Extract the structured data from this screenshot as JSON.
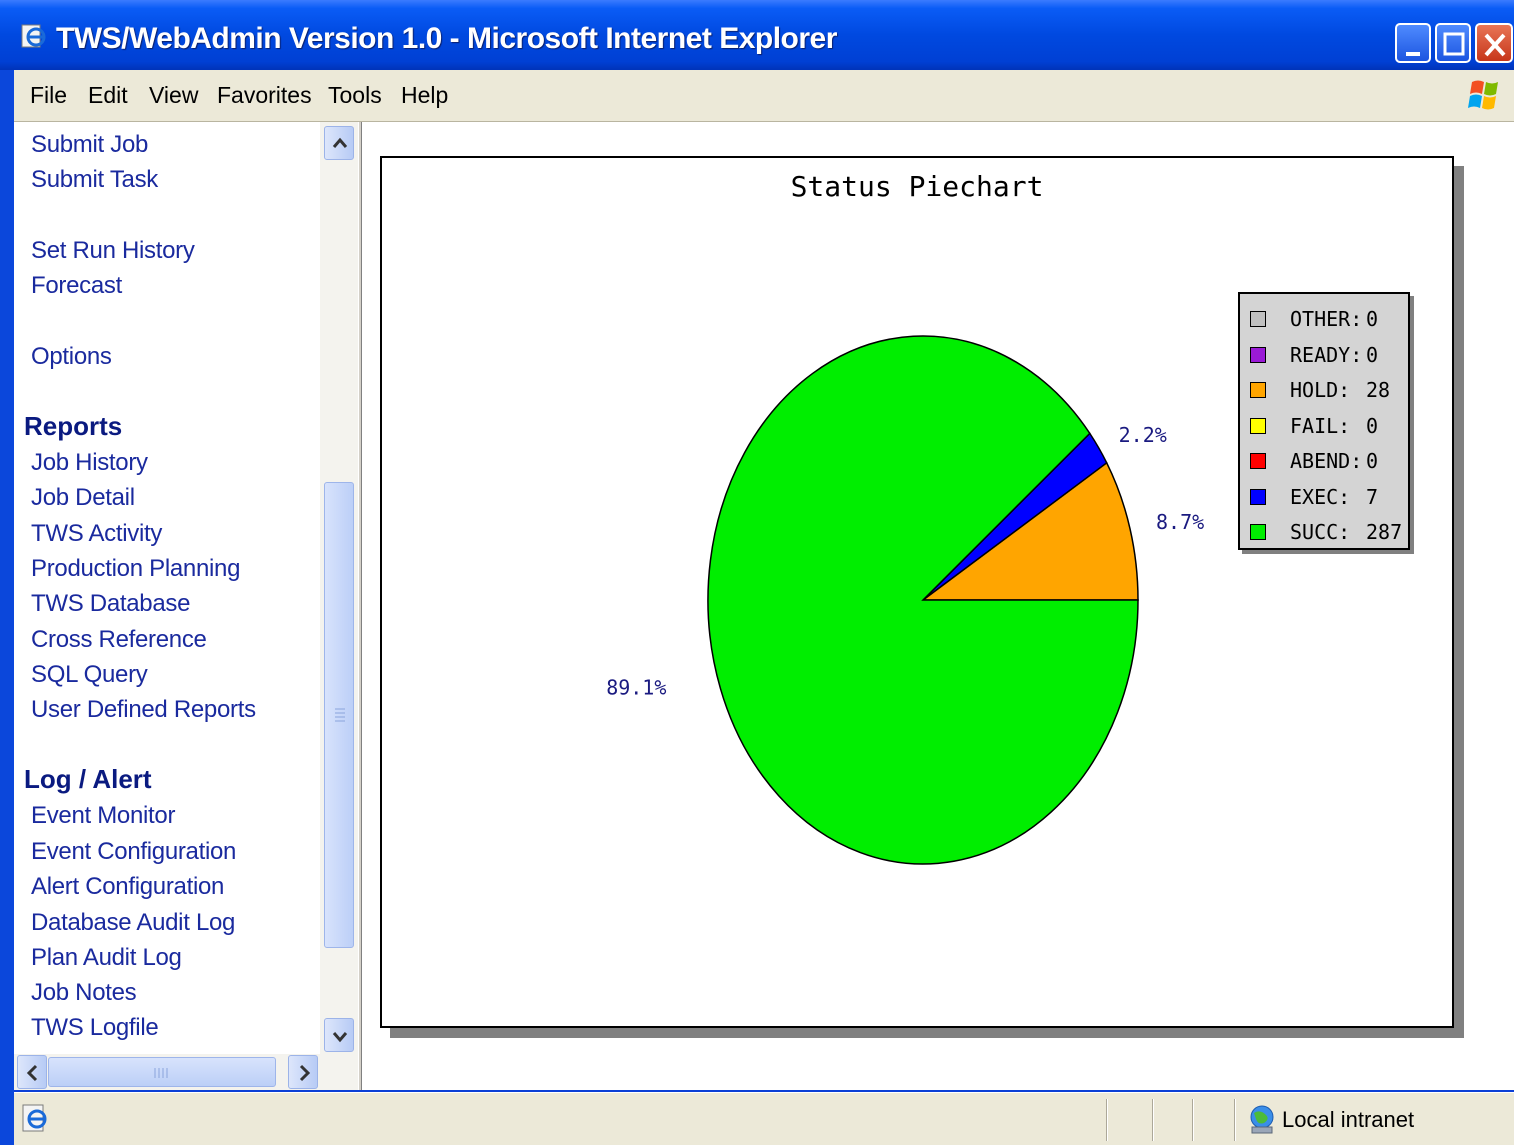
{
  "window": {
    "title": "TWS/WebAdmin Version 1.0 - Microsoft Internet Explorer"
  },
  "menu": {
    "file": "File",
    "edit": "Edit",
    "view": "View",
    "favorites": "Favorites",
    "tools": "Tools",
    "help": "Help"
  },
  "nav": {
    "submit_job": "Submit Job",
    "submit_task": "Submit Task",
    "set_run_history": "Set Run History",
    "forecast": "Forecast",
    "options": "Options",
    "reports_heading": "Reports",
    "reports": [
      "Job History",
      "Job Detail",
      "TWS Activity",
      "Production Planning",
      "TWS Database",
      "Cross Reference",
      "SQL Query",
      "User Defined Reports"
    ],
    "log_heading": "Log / Alert",
    "log": [
      "Event Monitor",
      "Event Configuration",
      "Alert Configuration",
      "Database Audit Log",
      "Plan Audit Log",
      "Job Notes",
      "TWS Logfile"
    ]
  },
  "chart_data": {
    "type": "pie",
    "title": "Status Piechart",
    "slices": [
      {
        "name": "OTHER",
        "value": 0,
        "color": "#c0c0c0"
      },
      {
        "name": "READY",
        "value": 0,
        "color": "#9a1ad6"
      },
      {
        "name": "HOLD",
        "value": 28,
        "color": "#ffa500",
        "label": "8.7%"
      },
      {
        "name": "FAIL",
        "value": 0,
        "color": "#ffff00"
      },
      {
        "name": "ABEND",
        "value": 0,
        "color": "#ff0000"
      },
      {
        "name": "EXEC",
        "value": 7,
        "color": "#0000ff",
        "label": "2.2%"
      },
      {
        "name": "SUCC",
        "value": 287,
        "color": "#00ee00",
        "label": "89.1%"
      }
    ],
    "legend_position": "top-right"
  },
  "status": {
    "zone": "Local intranet"
  }
}
